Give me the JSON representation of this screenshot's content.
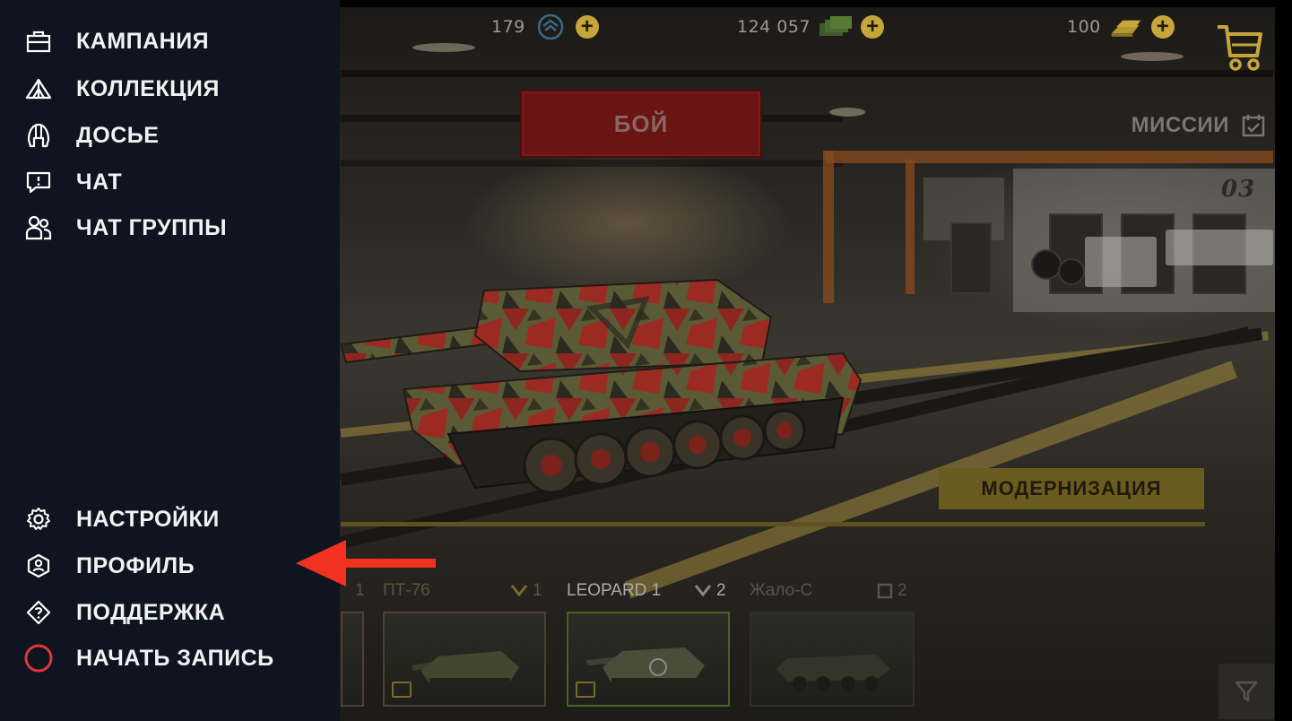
{
  "side_menu": {
    "items_top": [
      {
        "label": "КАМПАНИЯ",
        "icon": "briefcase-icon"
      },
      {
        "label": "КОЛЛЕКЦИЯ",
        "icon": "tent-icon"
      },
      {
        "label": "ДОСЬЕ",
        "icon": "helmet-icon"
      },
      {
        "label": "ЧАТ",
        "icon": "chat-bubble-icon"
      },
      {
        "label": "ЧАТ ГРУППЫ",
        "icon": "group-icon"
      }
    ],
    "items_bottom": [
      {
        "label": "НАСТРОЙКИ",
        "icon": "gear-icon"
      },
      {
        "label": "ПРОФИЛЬ",
        "icon": "profile-badge-icon"
      },
      {
        "label": "ПОДДЕРЖКА",
        "icon": "support-icon"
      },
      {
        "label": "НАЧАТЬ ЗАПИСЬ",
        "icon": "record-icon"
      }
    ]
  },
  "topbar": {
    "currencies": [
      {
        "value": "179",
        "icon": "rank-token-icon"
      },
      {
        "value": "124 057",
        "icon": "credits-icon"
      },
      {
        "value": "100",
        "icon": "gold-bars-icon"
      }
    ],
    "plus_label": "+",
    "shop_icon": "cart-icon"
  },
  "main": {
    "battle_label": "БОЙ",
    "missions_label": "МИССИИ",
    "modernize_label": "МОДЕРНИЗАЦИЯ",
    "hangar_number": "03"
  },
  "carousel": {
    "prev_tier": "1",
    "tanks": [
      {
        "name": "ПТ-76",
        "tier": "1",
        "active": false
      },
      {
        "name": "LEOPARD 1",
        "tier": "2",
        "active": true
      },
      {
        "name": "Жало-С",
        "tier": "2",
        "active": false
      }
    ]
  },
  "colors": {
    "menu_bg": "#0e1521",
    "accent_gold": "#c6a63a",
    "battle_red": "#6a1514",
    "arrow_red": "#f0321e",
    "record_red": "#e2353b"
  }
}
